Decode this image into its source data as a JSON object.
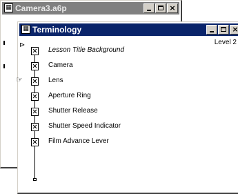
{
  "back_window": {
    "title": "Camera3.a6p"
  },
  "front_window": {
    "title": "Terminology",
    "level": "Level 2",
    "items": [
      {
        "label": "Lesson Title Background",
        "italic": true
      },
      {
        "label": "Camera"
      },
      {
        "label": "Lens"
      },
      {
        "label": "Aperture Ring"
      },
      {
        "label": "Shutter Release"
      },
      {
        "label": "Shutter Speed Indicator"
      },
      {
        "label": "Film Advance Lever"
      }
    ]
  },
  "window_buttons": {
    "close": "×"
  }
}
